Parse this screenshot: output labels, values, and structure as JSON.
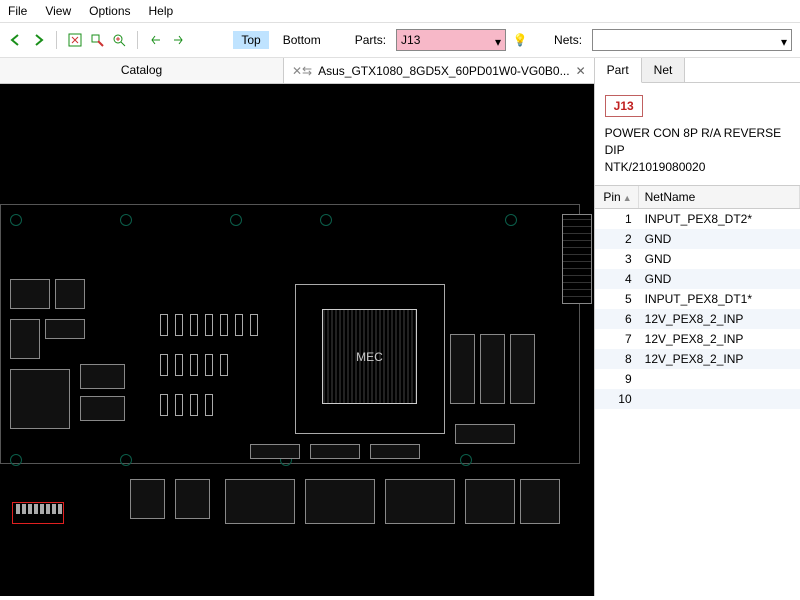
{
  "menu": {
    "file": "File",
    "view": "View",
    "options": "Options",
    "help": "Help"
  },
  "toolbar": {
    "layer_top": "Top",
    "layer_bottom": "Bottom",
    "parts_label": "Parts:",
    "parts_value": "J13",
    "nets_label": "Nets:",
    "nets_value": ""
  },
  "tabs": {
    "catalog": "Catalog",
    "document": "Asus_GTX1080_8GD5X_60PD01W0-VG0B0..."
  },
  "pcb": {
    "chip_label": "MEC"
  },
  "side": {
    "tab_part": "Part",
    "tab_net": "Net",
    "badge": "J13",
    "desc_line1": "POWER CON 8P R/A REVERSE DIP",
    "desc_line2": "NTK/21019080020",
    "col_pin": "Pin",
    "col_net": "NetName",
    "pins": [
      {
        "n": "1",
        "net": "INPUT_PEX8_DT2*"
      },
      {
        "n": "2",
        "net": "GND"
      },
      {
        "n": "3",
        "net": "GND"
      },
      {
        "n": "4",
        "net": "GND"
      },
      {
        "n": "5",
        "net": "INPUT_PEX8_DT1*"
      },
      {
        "n": "6",
        "net": "12V_PEX8_2_INP"
      },
      {
        "n": "7",
        "net": "12V_PEX8_2_INP"
      },
      {
        "n": "8",
        "net": "12V_PEX8_2_INP"
      },
      {
        "n": "9",
        "net": ""
      },
      {
        "n": "10",
        "net": ""
      }
    ]
  }
}
